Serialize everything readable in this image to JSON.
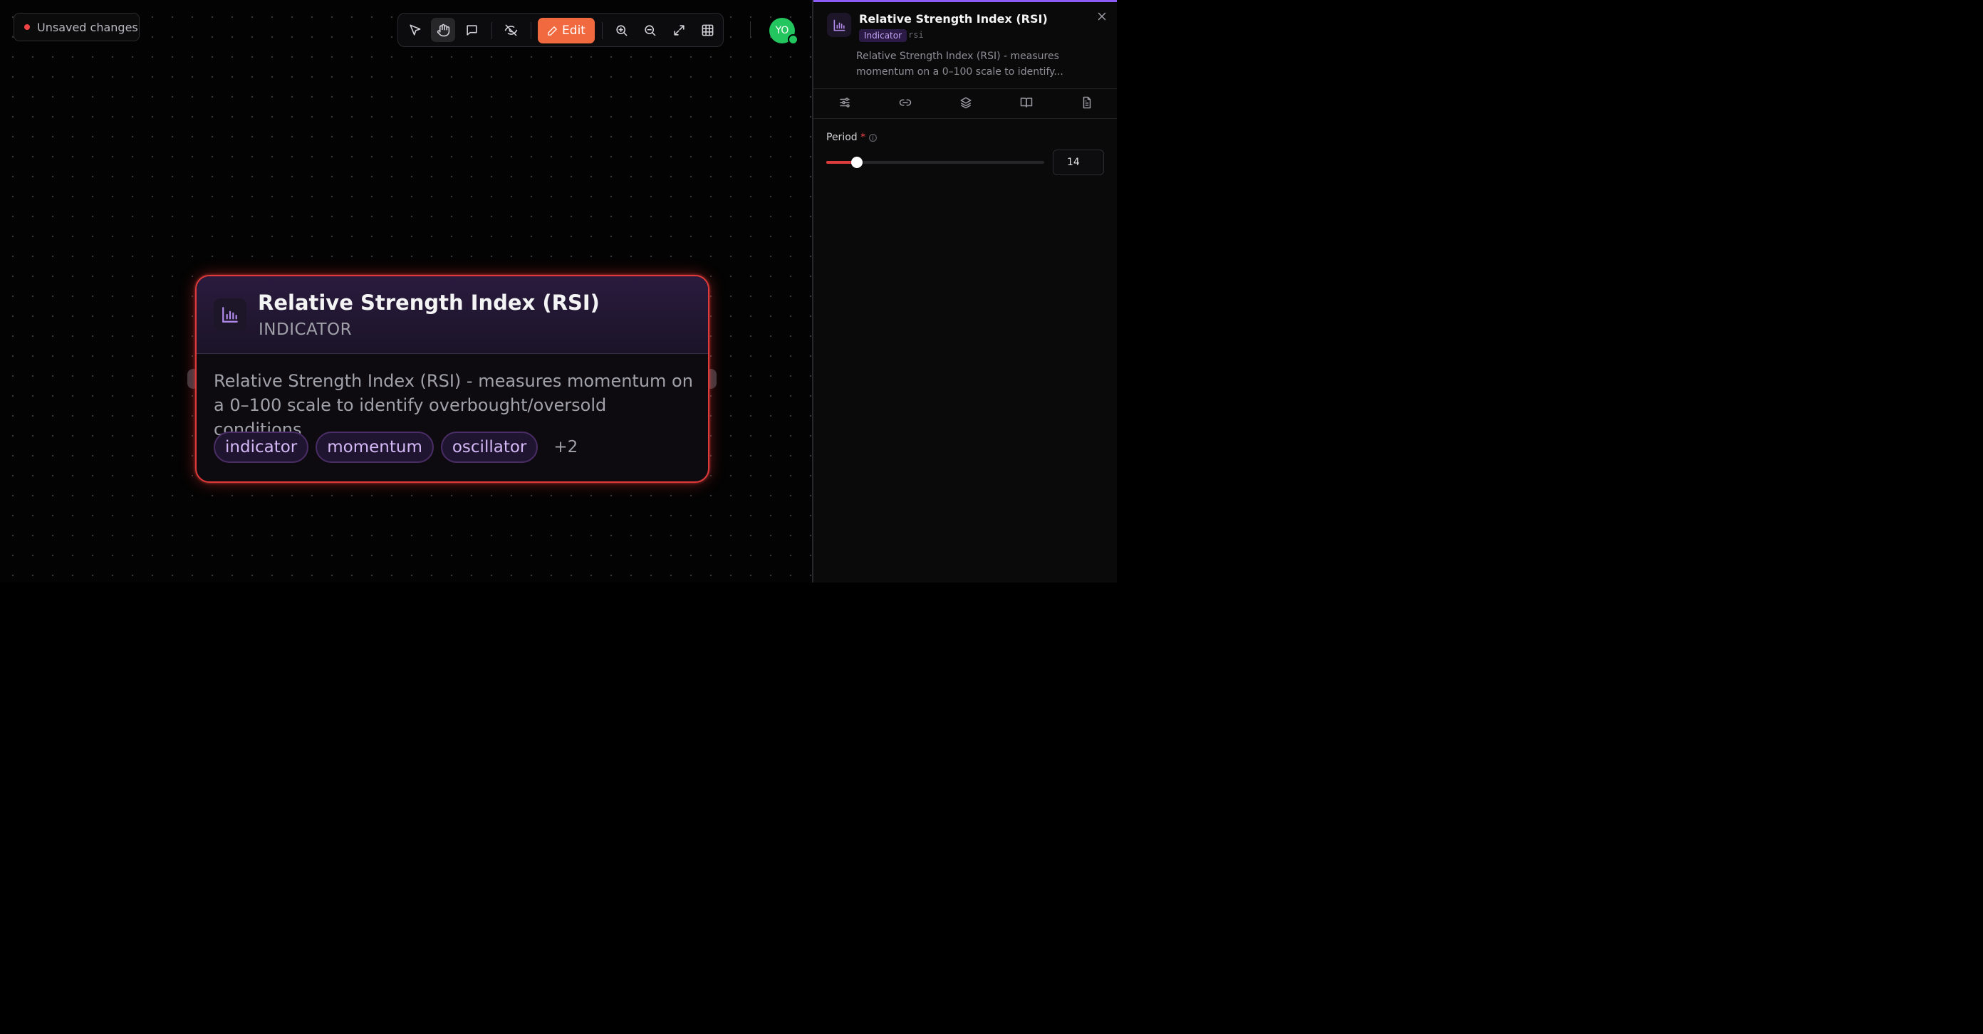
{
  "status": {
    "unsaved_label": "Unsaved changes"
  },
  "toolbar": {
    "edit_label": "Edit",
    "tools": [
      "select-pointer",
      "pan-hand",
      "comment",
      "hide-visibility",
      "zoom-in",
      "zoom-out",
      "fit-expand",
      "grid"
    ],
    "active_tool": "pan-hand"
  },
  "user": {
    "initials": "YO",
    "status": "online"
  },
  "node": {
    "title": "Relative Strength Index (RSI)",
    "type": "INDICATOR",
    "description": "Relative Strength Index (RSI) - measures momentum on a 0–100 scale to identify overbought/oversold conditions",
    "tags": [
      "indicator",
      "momentum",
      "oscillator"
    ],
    "more_tags": "+2",
    "icon": "bar-chart-icon"
  },
  "panel": {
    "title": "Relative Strength Index (RSI)",
    "badge": "Indicator",
    "slug": "rsi",
    "description_line1": "Relative Strength Index (RSI) - measures",
    "description_line2": "momentum on a 0–100 scale to identify...",
    "tabs": [
      "sliders-icon",
      "link-icon",
      "layers-icon",
      "book-icon",
      "file-text-icon"
    ],
    "field": {
      "label": "Period",
      "required_mark": "*",
      "value": "14",
      "slider_fraction": 0.14
    }
  },
  "colors": {
    "accent_purple": "#8b5cf6",
    "edit_orange": "#f16a3f",
    "node_border_red": "#e03a3a",
    "avatar_green": "#22c55e"
  }
}
